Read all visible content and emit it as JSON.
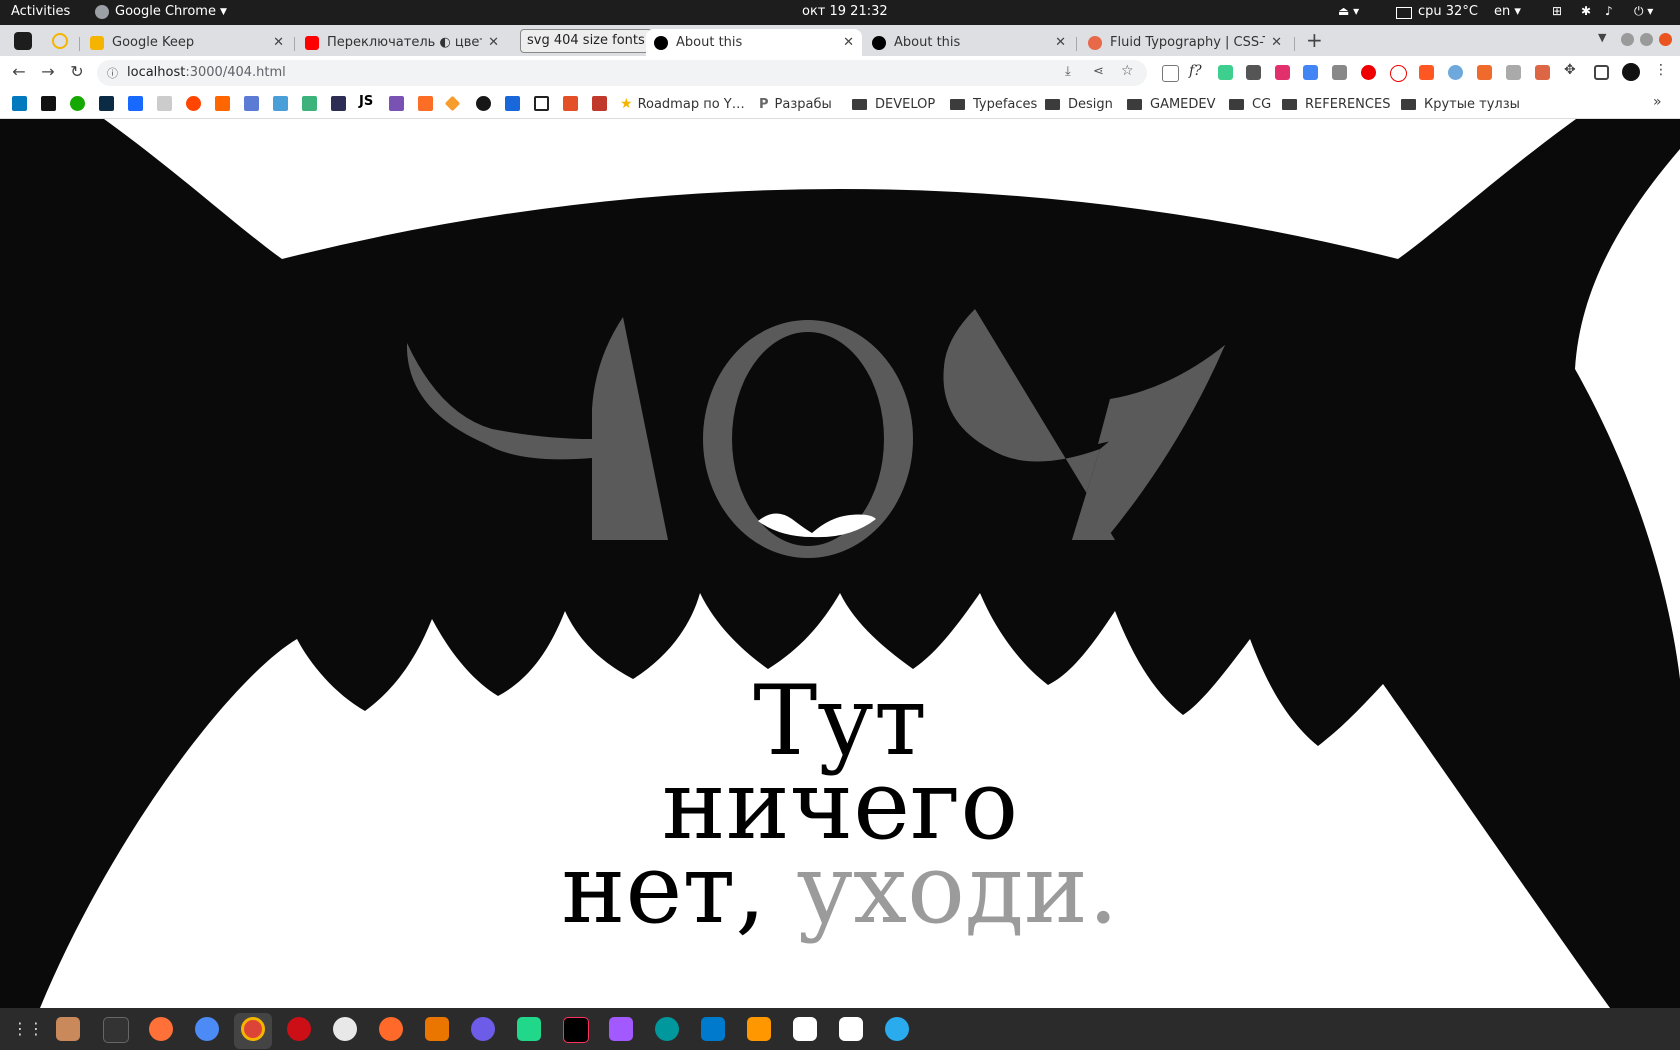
{
  "system_bar": {
    "activities": "Activities",
    "app_name": "Google Chrome",
    "datetime": "окт 19  21:32",
    "cpu": "cpu 32°C",
    "lang": "en"
  },
  "tabs": [
    {
      "label": "Google Keep",
      "favicon_color": "#f4b400"
    },
    {
      "label": "Переключатель ◐ цвета",
      "favicon_color": "#ff0000"
    },
    {
      "label": "svg 404 size fonts",
      "favicon_color": ""
    },
    {
      "label": "About this",
      "favicon_color": "#000000",
      "active": true
    },
    {
      "label": "About this",
      "favicon_color": "#000000"
    },
    {
      "label": "Fluid Typography | CSS-Tricks",
      "favicon_color": "#e8684a"
    }
  ],
  "address": {
    "host": "localhost",
    "path": ":3000/404.html"
  },
  "bookmarks": {
    "roadmap": "Roadmap по Y…",
    "razraby": "Разрабы",
    "develop": "DEVELOP",
    "typefaces": "Typefaces",
    "design": "Design",
    "gamedev": "GAMEDEV",
    "cg": "CG",
    "references": "REFERENCES",
    "tools": "Крутые тулзы",
    "js": "JS"
  },
  "page": {
    "error_code": "404",
    "line1": "Тут",
    "line2": "ничего",
    "line3_main": "нет,",
    "line3_dim": "уходи."
  },
  "colors": {
    "monster": "#0a0a0a",
    "digits": "#5a5a5a",
    "dim_text": "#9b9b9b"
  }
}
